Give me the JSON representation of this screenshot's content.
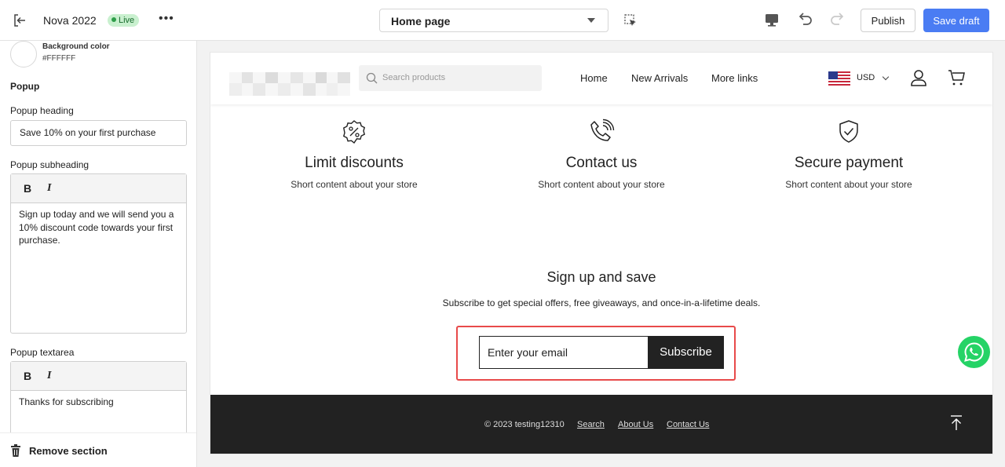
{
  "topbar": {
    "title": "Nova 2022",
    "status": "Live",
    "more": "•••",
    "page_select": "Home page",
    "publish": "Publish",
    "save_draft": "Save draft"
  },
  "sidebar": {
    "background_color_label": "Background color",
    "background_color_value": "#FFFFFF",
    "section_title": "Popup",
    "heading_label": "Popup heading",
    "heading_value": "Save 10% on your first purchase",
    "subheading_label": "Popup subheading",
    "subheading_value": "Sign up today and we will send you a 10% discount code towards your first purchase.",
    "textarea_label": "Popup textarea",
    "textarea_value": "Thanks for subscribing",
    "bold": "B",
    "italic": "I",
    "remove_section": "Remove section"
  },
  "store": {
    "search_placeholder": "Search products",
    "nav": [
      "Home",
      "New Arrivals",
      "More links"
    ],
    "currency": "USD",
    "features": [
      {
        "icon": "discount-icon",
        "title": "Limit discounts",
        "text": "Short content about your store"
      },
      {
        "icon": "phone-icon",
        "title": "Contact us",
        "text": "Short content about your store"
      },
      {
        "icon": "shield-check-icon",
        "title": "Secure payment",
        "text": "Short content about your store"
      }
    ],
    "signup_title": "Sign up and save",
    "signup_sub": "Subscribe to get special offers, free giveaways, and once-in-a-lifetime deals.",
    "email_placeholder": "Enter your email",
    "subscribe": "Subscribe",
    "footer_copy": "© 2023 testing12310",
    "footer_links": [
      "Search",
      "About Us",
      "Contact Us"
    ]
  },
  "colors": {
    "accent": "#4a7cf3",
    "live_badge": "#c9f0cf",
    "highlight": "#e84a4a",
    "footer": "#222222",
    "whatsapp": "#25d366"
  }
}
